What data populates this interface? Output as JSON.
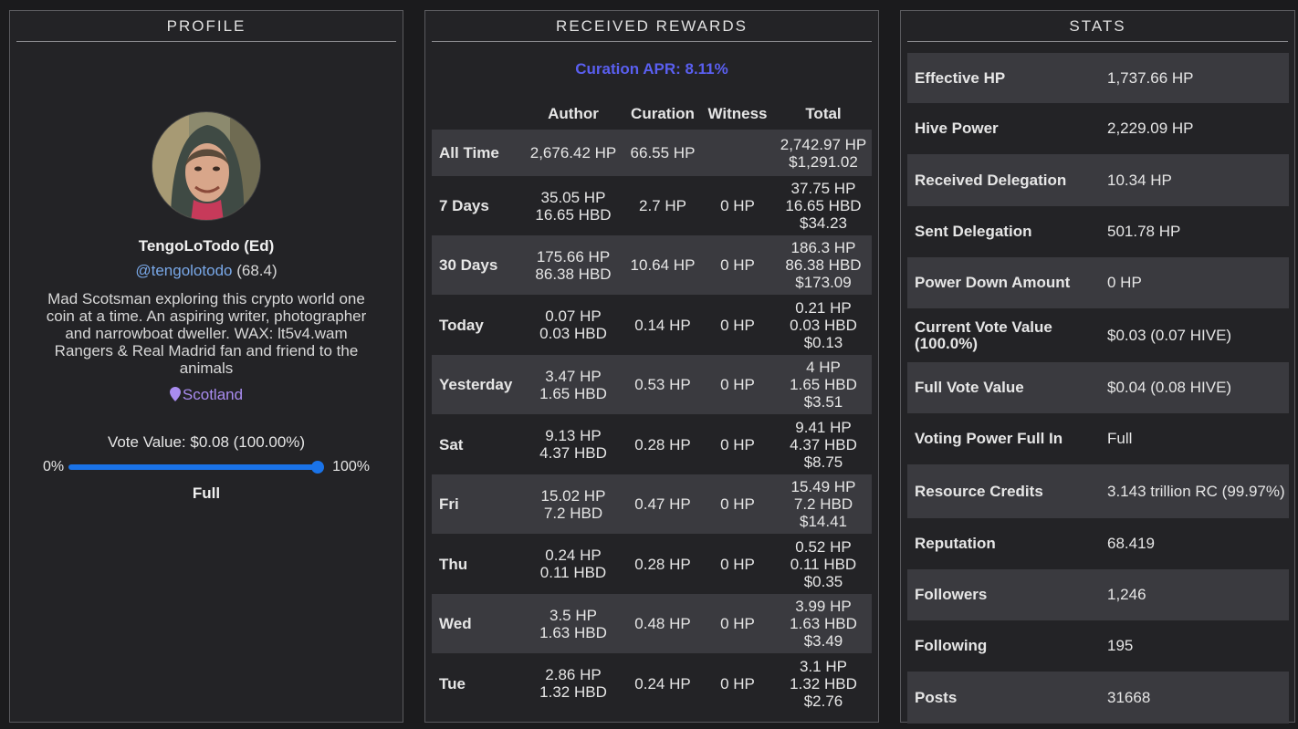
{
  "profile": {
    "title": "PROFILE",
    "name": "TengoLoTodo (Ed)",
    "handle": "@tengolotodo",
    "reputation": "(68.4)",
    "bio": "Mad Scotsman exploring this crypto world one coin at a time. An aspiring writer, photographer and narrowboat dweller. WAX: lt5v4.wam Rangers & Real Madrid fan and friend to the animals",
    "location": "Scotland",
    "vote_value": "Vote Value: $0.08 (100.00%)",
    "slider_min": "0%",
    "slider_max": "100%",
    "slider_level": 1.0,
    "status": "Full",
    "accent_color": "#1a73e8",
    "location_color": "#a98cf0",
    "location_icon": "map-pin-icon"
  },
  "rewards": {
    "title": "RECEIVED REWARDS",
    "apr": "Curation APR: 8.11%",
    "columns": [
      "",
      "Author",
      "Curation",
      "Witness",
      "Total"
    ],
    "rows": [
      {
        "period": "All Time",
        "author": "2,676.42 HP",
        "curation": "66.55 HP",
        "witness": "",
        "total": "2,742.97 HP\n$1,291.02"
      },
      {
        "period": "7 Days",
        "author": "35.05 HP\n16.65 HBD",
        "curation": "2.7 HP",
        "witness": "0 HP",
        "total": "37.75 HP\n16.65 HBD\n$34.23"
      },
      {
        "period": "30 Days",
        "author": "175.66 HP\n86.38 HBD",
        "curation": "10.64 HP",
        "witness": "0 HP",
        "total": "186.3 HP\n86.38 HBD\n$173.09"
      },
      {
        "period": "Today",
        "author": "0.07 HP\n0.03 HBD",
        "curation": "0.14 HP",
        "witness": "0 HP",
        "total": "0.21 HP\n0.03 HBD\n$0.13"
      },
      {
        "period": "Yesterday",
        "author": "3.47 HP\n1.65 HBD",
        "curation": "0.53 HP",
        "witness": "0 HP",
        "total": "4 HP\n1.65 HBD\n$3.51"
      },
      {
        "period": "Sat",
        "author": "9.13 HP\n4.37 HBD",
        "curation": "0.28 HP",
        "witness": "0 HP",
        "total": "9.41 HP\n4.37 HBD\n$8.75"
      },
      {
        "period": "Fri",
        "author": "15.02 HP\n7.2 HBD",
        "curation": "0.47 HP",
        "witness": "0 HP",
        "total": "15.49 HP\n7.2 HBD\n$14.41"
      },
      {
        "period": "Thu",
        "author": "0.24 HP\n0.11 HBD",
        "curation": "0.28 HP",
        "witness": "0 HP",
        "total": "0.52 HP\n0.11 HBD\n$0.35"
      },
      {
        "period": "Wed",
        "author": "3.5 HP\n1.63 HBD",
        "curation": "0.48 HP",
        "witness": "0 HP",
        "total": "3.99 HP\n1.63 HBD\n$3.49"
      },
      {
        "period": "Tue",
        "author": "2.86 HP\n1.32 HBD",
        "curation": "0.24 HP",
        "witness": "0 HP",
        "total": "3.1 HP\n1.32 HBD\n$2.76"
      }
    ]
  },
  "stats": {
    "title": "STATS",
    "rows": [
      {
        "label": "Effective HP",
        "value": "1,737.66 HP"
      },
      {
        "label": "Hive Power",
        "value": "2,229.09 HP"
      },
      {
        "label": "Received Delegation",
        "value": "10.34 HP"
      },
      {
        "label": "Sent Delegation",
        "value": "501.78 HP"
      },
      {
        "label": "Power Down Amount",
        "value": "0 HP"
      },
      {
        "label": "Current Vote Value (100.0%)",
        "value": "$0.03 (0.07 HIVE)"
      },
      {
        "label": "Full Vote Value",
        "value": "$0.04 (0.08 HIVE)"
      },
      {
        "label": "Voting Power Full In",
        "value": "Full"
      },
      {
        "label": "Resource Credits",
        "value": "3.143 trillion RC (99.97%)"
      },
      {
        "label": "Reputation",
        "value": "68.419"
      },
      {
        "label": "Followers",
        "value": "1,246"
      },
      {
        "label": "Following",
        "value": "195"
      },
      {
        "label": "Posts",
        "value": "31668"
      }
    ]
  }
}
